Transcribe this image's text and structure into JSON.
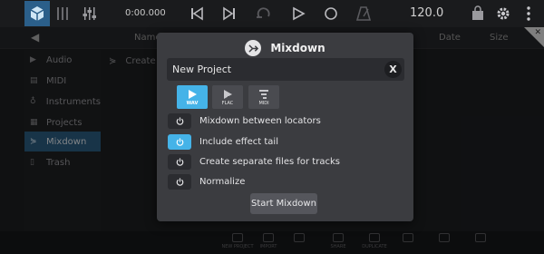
{
  "toolbar": {
    "time_display": "0:00.000",
    "tempo": "120.0"
  },
  "columns": {
    "name": "Name",
    "date": "Date",
    "size": "Size"
  },
  "sidebar": {
    "items": [
      {
        "label": "Audio",
        "icon": "play-icon"
      },
      {
        "label": "MIDI",
        "icon": "document-icon"
      },
      {
        "label": "Instruments",
        "icon": "instrument-icon"
      },
      {
        "label": "Projects",
        "icon": "projects-icon"
      },
      {
        "label": "Mixdown",
        "icon": "mixdown-icon",
        "active": true
      },
      {
        "label": "Trash",
        "icon": "trash-icon"
      }
    ]
  },
  "content": {
    "row_label": "Create"
  },
  "dialog": {
    "title": "Mixdown",
    "project_name": "New Project",
    "clear_label": "X",
    "formats": [
      {
        "label": "WAV",
        "selected": true
      },
      {
        "label": "FLAC",
        "selected": false
      },
      {
        "label": "MIDI",
        "selected": false
      }
    ],
    "options": [
      {
        "label": "Mixdown between locators",
        "enabled": false
      },
      {
        "label": "Include effect tail",
        "enabled": true
      },
      {
        "label": "Create separate files for tracks",
        "enabled": false
      },
      {
        "label": "Normalize",
        "enabled": false
      }
    ],
    "start_label": "Start Mixdown"
  },
  "bottombar": {
    "items": [
      "NEW PROJECT",
      "IMPORT",
      "",
      "SHARE",
      "DUPLICATE",
      "",
      "",
      ""
    ]
  },
  "colors": {
    "accent": "#45b3e8",
    "sidebar_active": "#2c5f84",
    "dialog_bg": "#3b3c40"
  }
}
